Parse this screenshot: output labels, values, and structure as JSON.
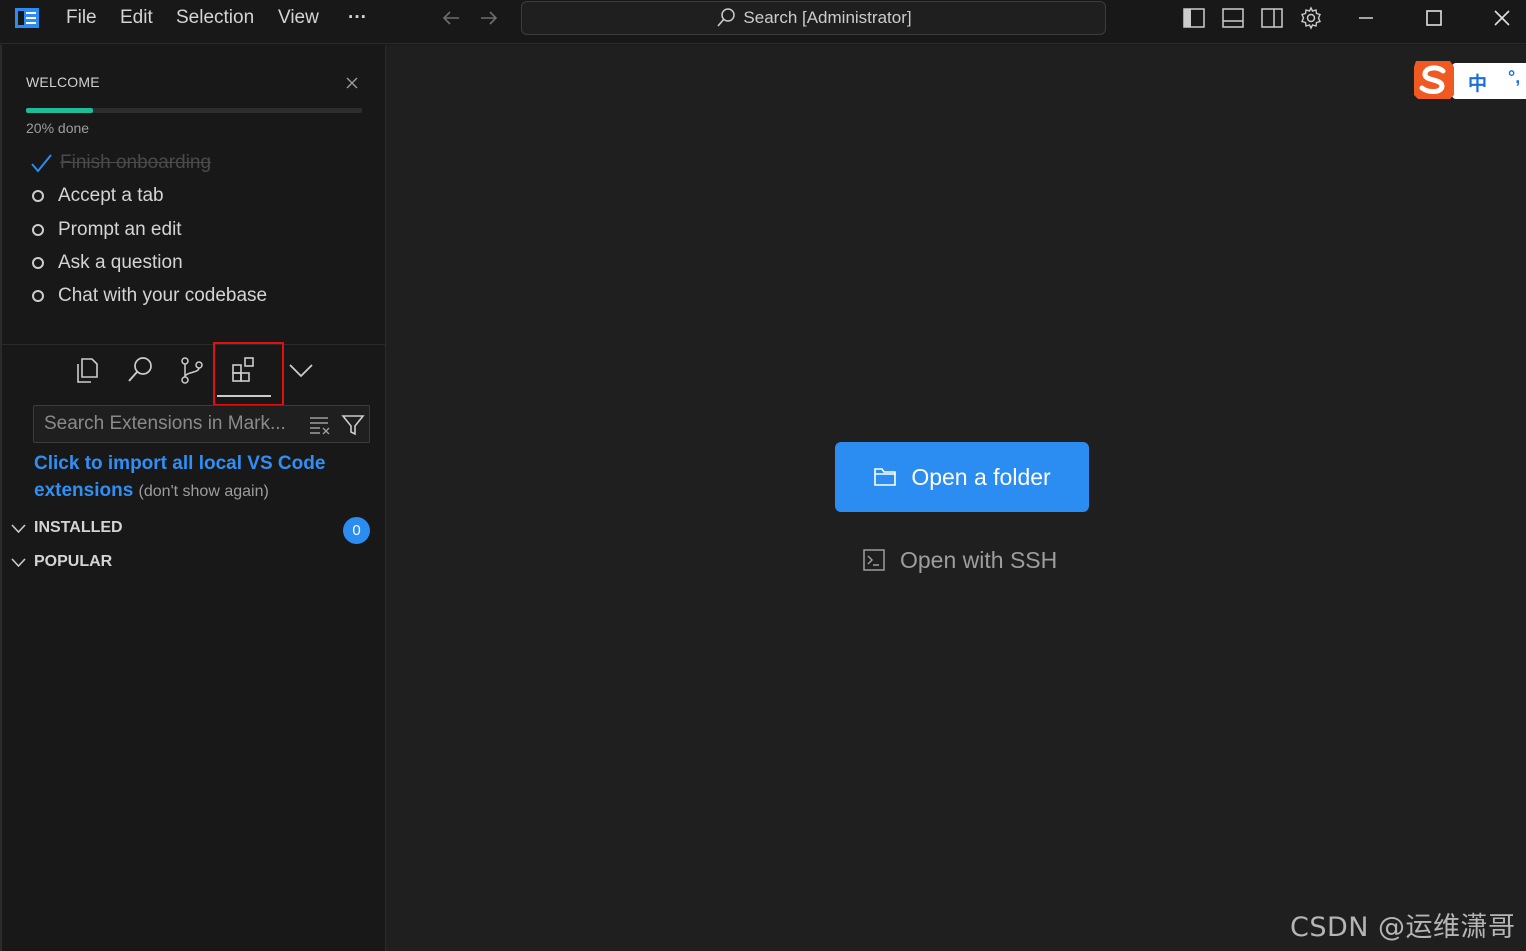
{
  "titlebar": {
    "menu": [
      "File",
      "Edit",
      "Selection",
      "View",
      "···"
    ],
    "search_placeholder": "Search [Administrator]"
  },
  "welcome": {
    "title": "WELCOME",
    "progress_percent": 20,
    "progress_label": "20% done",
    "tasks": [
      {
        "label": "Finish onboarding",
        "done": true
      },
      {
        "label": "Accept a tab",
        "done": false
      },
      {
        "label": "Prompt an edit",
        "done": false
      },
      {
        "label": "Ask a question",
        "done": false
      },
      {
        "label": "Chat with your codebase",
        "done": false
      }
    ]
  },
  "views": {
    "icons": [
      "explorer-icon",
      "search-icon",
      "source-control-icon",
      "extensions-icon",
      "chevron-down-icon"
    ],
    "active": "extensions-icon"
  },
  "extensions": {
    "search_placeholder": "Search Extensions in Mark...",
    "import_link": "Click to import all local VS Code extensions",
    "import_dismiss": "(don't show again)",
    "sections": [
      {
        "label": "INSTALLED",
        "count": "0"
      },
      {
        "label": "POPULAR"
      }
    ]
  },
  "editor": {
    "open_folder_label": "Open a folder",
    "open_ssh_label": "Open with SSH"
  },
  "ime": {
    "label": "中",
    "punct": "°,"
  },
  "watermark": "CSDN @运维潇哥",
  "colors": {
    "accent": "#2b8cf2",
    "progress": "#1ebc97",
    "highlight": "#e01010",
    "background": "#181818"
  }
}
